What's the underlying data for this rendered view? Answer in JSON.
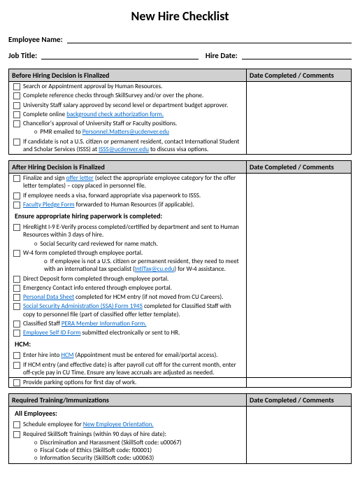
{
  "title": "New Hire Checklist",
  "fields": {
    "employee_name_label": "Employee Name:",
    "job_title_label": "Job Title:",
    "hire_date_label": "Hire Date:"
  },
  "col2_header": "Date Completed / Comments",
  "section1": {
    "header": "Before Hiring Decision is Finalized",
    "items": {
      "i1": "Search or Appointment approval by Human Resources.",
      "i2": "Complete reference checks through SkillSurvey and/or over the phone.",
      "i3": "University Staff salary approved by second level or department budget approver.",
      "i4_pre": "Complete online ",
      "i4_link": "background check authorization form.",
      "i5": "Chancellor's approval of University Staff or Faculty positions.",
      "i5_sub_pre": "PMR emailed to ",
      "i5_sub_link": "Personnel.Matters@ucdenver.edu",
      "i6_a": "If candidate is not a U.S. citizen or permanent resident, contact International Student and Scholar Services (ISSS) at ",
      "i6_link": "ISSS@ucdenver.edu",
      "i6_b": " to discuss visa options."
    }
  },
  "section2": {
    "header": "After Hiring Decision is Finalized",
    "items": {
      "i1_a": "Finalize and sign ",
      "i1_link": "offer letter",
      "i1_b": " (select the appropriate employee category for the offer letter templates) – copy placed in personnel file.",
      "i2": "If employee needs a visa, forward appropriate visa paperwork to ISSS.",
      "i3_link": "Faculty Pledge Form",
      "i3_b": " forwarded to Human Resources (if applicable)."
    },
    "subhead1": "Ensure appropriate hiring paperwork is completed:",
    "group2": {
      "i1": "HireRight I-9 E-Verify process completed/certified by department and sent to Human Resources within 3 days of hire.",
      "i1_sub": "Social Security card reviewed for name match.",
      "i2": "W-4 form completed through employee portal.",
      "i2_sub_a": "If employee is not a U.S. citizen or permanent resident, they need to meet with an international tax specialist (",
      "i2_sub_link": "IntlTax@cu.edu",
      "i2_sub_b": ") for W-4 assistance.",
      "i3": "Direct Deposit form completed through employee portal.",
      "i4": "Emergency Contact info entered through employee portal.",
      "i5_link": "Personal Data Sheet",
      "i5_b": " completed for HCM entry (if not moved from CU Careers).",
      "i6_link": "Social Security Administration (SSA) Form 1945",
      "i6_b": " completed for Classified Staff with copy to personnel file (part of classified offer letter template).",
      "i7_pre": "Classified Staff ",
      "i7_link": "PERA Member Information Form.",
      "i8_link": "Employee Self ID Form",
      "i8_b": " submitted electronically or sent to HR."
    },
    "subhead2": "HCM:",
    "group3": {
      "i1_a": "Enter hire into ",
      "i1_link": "HCM",
      "i1_b": " (Appointment must be entered for email/portal access).",
      "i2": "If HCM entry (and effective date) is after payroll cut off for the current month, enter off-cycle pay in CU Time. Ensure any leave accruals are adjusted as needed."
    },
    "group4": {
      "i1": "Provide parking options for first day of work."
    }
  },
  "section3": {
    "header": "Required Training/Immunizations",
    "subhead": "All Employees:",
    "items": {
      "i1_a": "Schedule employee for ",
      "i1_link": "New Employee Orientation.",
      "i2": "Required SkillSoft Trainings (within 90 days of hire date):",
      "sub1": "Discrimination and Harassment (SkillSoft code: u00067)",
      "sub2": "Fiscal Code of Ethics (SkillSoft code: f00001)",
      "sub3": "Information Security (SkillSoft code: u00063)"
    }
  }
}
